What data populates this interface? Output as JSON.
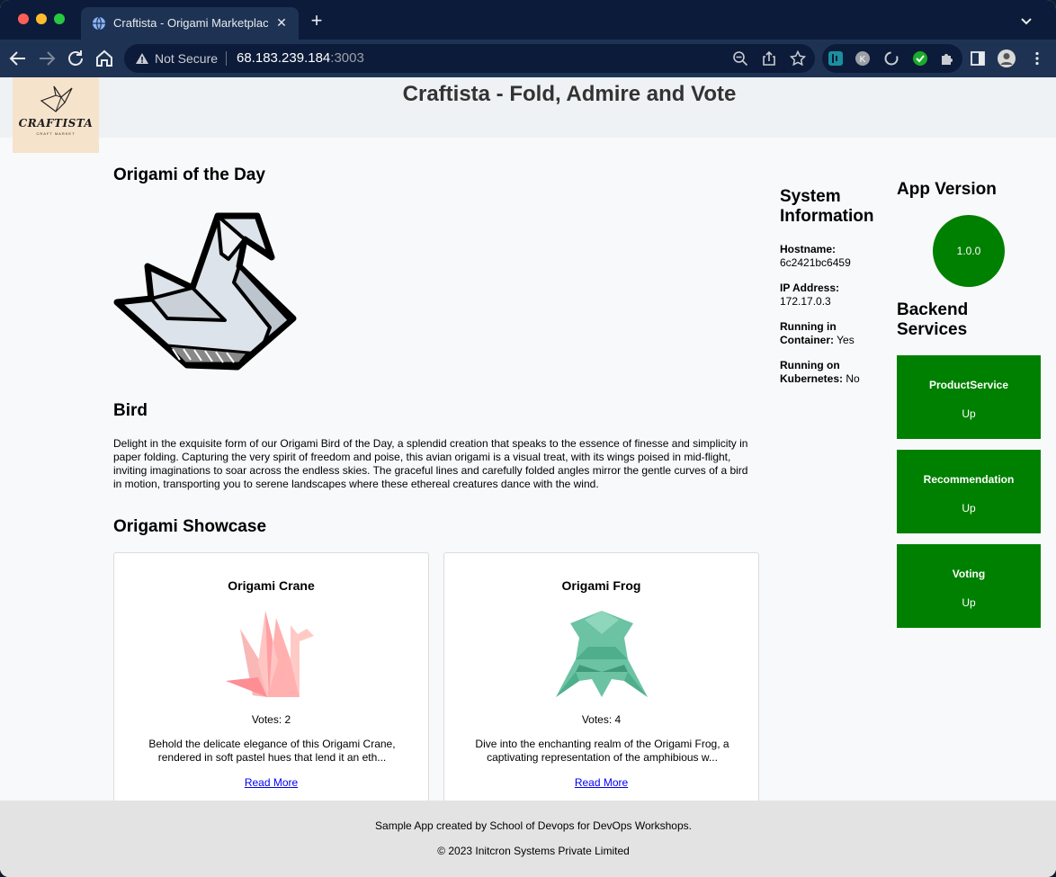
{
  "browser": {
    "tab_title": "Craftista - Origami Marketplac",
    "security_label": "Not Secure",
    "url_host": "68.183.239.184",
    "url_port": ":3003"
  },
  "header": {
    "logo_text": "CRAFTISTA",
    "logo_subtext": "CRAFT MARKET",
    "title": "Craftista - Fold, Admire and Vote"
  },
  "origami_of_day": {
    "heading": "Origami of the Day",
    "name": "Bird",
    "description": "Delight in the exquisite form of our Origami Bird of the Day, a splendid creation that speaks to the essence of finesse and simplicity in paper folding. Capturing the very spirit of freedom and poise, this avian origami is a visual treat, with its wings poised in mid-flight, inviting imaginations to soar across the endless skies. The graceful lines and carefully folded angles mirror the gentle curves of a bird in motion, transporting you to serene landscapes where these ethereal creatures dance with the wind."
  },
  "showcase": {
    "heading": "Origami Showcase",
    "cards": [
      {
        "title": "Origami Crane",
        "votes": "Votes: 2",
        "description": "Behold the delicate elegance of this Origami Crane, rendered in soft pastel hues that lend it an eth...",
        "link": "Read More"
      },
      {
        "title": "Origami Frog",
        "votes": "Votes: 4",
        "description": "Dive into the enchanting realm of the Origami Frog, a captivating representation of the amphibious w...",
        "link": "Read More"
      }
    ]
  },
  "system_info": {
    "heading": "System Information",
    "hostname_label": "Hostname:",
    "hostname": "6c2421bc6459",
    "ip_label": "IP Address:",
    "ip": "172.17.0.3",
    "container_label": "Running in Container:",
    "container": "Yes",
    "k8s_label": "Running on Kubernetes:",
    "k8s": "No"
  },
  "app_version": {
    "heading": "App Version",
    "version": "1.0.0"
  },
  "backend": {
    "heading": "Backend Services",
    "services": [
      {
        "name": "ProductService",
        "status": "Up"
      },
      {
        "name": "Recommendation",
        "status": "Up"
      },
      {
        "name": "Voting",
        "status": "Up"
      }
    ]
  },
  "footer": {
    "line1": "Sample App created by School of Devops for DevOps Workshops.",
    "line2": "© 2023 Initcron Systems Private Limited"
  },
  "colors": {
    "service_up": "#008000",
    "chrome_dark": "#0d1b3a",
    "chrome_toolbar": "#1e3354"
  }
}
